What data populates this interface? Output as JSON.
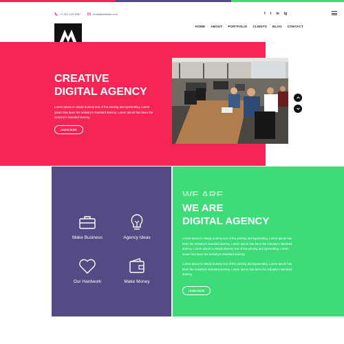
{
  "colors": {
    "hero": "#f52556",
    "purple": "#544a84",
    "green": "#3ddc78",
    "stripe": [
      "#f52556",
      "#544a84",
      "#3ddc78"
    ]
  },
  "header": {
    "phone": "+1 021 123 4567",
    "email": "email@website.com",
    "social": [
      "f",
      "t",
      "in",
      "ig"
    ],
    "social_icons": [
      "facebook-icon",
      "twitter-icon",
      "linkedin-icon",
      "instagram-icon"
    ],
    "menu_icon": "hamburger-icon"
  },
  "nav": {
    "items": [
      "HOME",
      "ABOUT",
      "PORTFOLIO",
      "CLIENTS",
      "BLOG",
      "CONTACT"
    ]
  },
  "hero": {
    "title_line1": "CREATIVE",
    "title_line2": "DIGITAL AGENCY",
    "text": "Lorem Ipsum is simply dummy text of the printing and typesetting. Lorem Ipsum has been the industry's standard dummy. Lorem Ipsum has been the industry's standard dummy.",
    "button": "LEARN MORE"
  },
  "features": [
    {
      "label": "Make Business",
      "icon": "briefcase-icon"
    },
    {
      "label": "Agency Ideas",
      "icon": "lightbulb-icon"
    },
    {
      "label": "Our Hardwork",
      "icon": "heart-icon"
    },
    {
      "label": "Make Money",
      "icon": "wallet-icon"
    }
  ],
  "about": {
    "ghost_title": "WE ARE",
    "title_line1": "WE ARE",
    "title_line2": "DIGITAL AGENCY",
    "paragraph1": "Lorem Ipsum is simply dummy text of the printing and typesetting. Lorem Ipsum has been the industry's standard dummy. Lorem Ipsum has been the industry's standard dummy. Lorem Ipsum is simply dummy text of the printing and typesetting. Lorem Ipsum has been the industry's standard dummy.",
    "paragraph2": "Lorem Ipsum is simply dummy text of the printing and typesetting. Lorem Ipsum has been the industry's standard dummy. Lorem Ipsum has been the industry's standard dummy.",
    "button": "LEARN MORE"
  }
}
